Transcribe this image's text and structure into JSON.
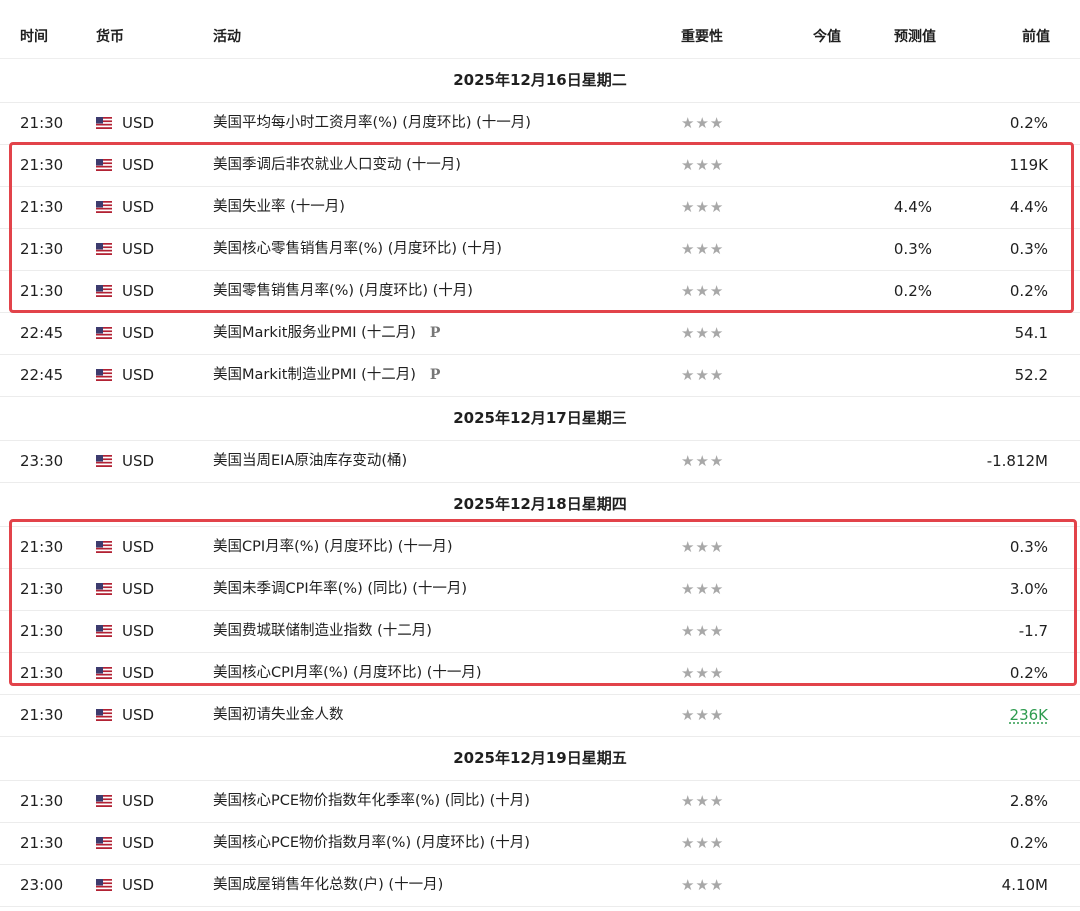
{
  "header": {
    "time": "时间",
    "currency": "货币",
    "event": "活动",
    "importance": "重要性",
    "actual": "今值",
    "forecast": "预测值",
    "previous": "前值"
  },
  "stars": "★★★",
  "prelim_label": "P",
  "sections": [
    {
      "date": "2025年12月16日星期二",
      "rows": [
        {
          "time": "21:30",
          "currency": "USD",
          "event": "美国平均每小时工资月率(%) (月度环比) (十一月)",
          "actual": "",
          "forecast": "",
          "previous": "0.2%"
        },
        {
          "time": "21:30",
          "currency": "USD",
          "event": "美国季调后非农就业人口变动 (十一月)",
          "actual": "",
          "forecast": "",
          "previous": "119K"
        },
        {
          "time": "21:30",
          "currency": "USD",
          "event": "美国失业率 (十一月)",
          "actual": "",
          "forecast": "4.4%",
          "previous": "4.4%"
        },
        {
          "time": "21:30",
          "currency": "USD",
          "event": "美国核心零售销售月率(%) (月度环比) (十月)",
          "actual": "",
          "forecast": "0.3%",
          "previous": "0.3%"
        },
        {
          "time": "21:30",
          "currency": "USD",
          "event": "美国零售销售月率(%) (月度环比) (十月)",
          "actual": "",
          "forecast": "0.2%",
          "previous": "0.2%"
        },
        {
          "time": "22:45",
          "currency": "USD",
          "event": "美国Markit服务业PMI (十二月)",
          "actual": "",
          "forecast": "",
          "previous": "54.1"
        },
        {
          "time": "22:45",
          "currency": "USD",
          "event": "美国Markit制造业PMI (十二月)",
          "actual": "",
          "forecast": "",
          "previous": "52.2"
        }
      ]
    },
    {
      "date": "2025年12月17日星期三",
      "rows": [
        {
          "time": "23:30",
          "currency": "USD",
          "event": "美国当周EIA原油库存变动(桶)",
          "actual": "",
          "forecast": "",
          "previous": "-1.812M"
        }
      ]
    },
    {
      "date": "2025年12月18日星期四",
      "rows": [
        {
          "time": "21:30",
          "currency": "USD",
          "event": "美国CPI月率(%) (月度环比) (十一月)",
          "actual": "",
          "forecast": "",
          "previous": "0.3%"
        },
        {
          "time": "21:30",
          "currency": "USD",
          "event": "美国未季调CPI年率(%) (同比) (十一月)",
          "actual": "",
          "forecast": "",
          "previous": "3.0%"
        },
        {
          "time": "21:30",
          "currency": "USD",
          "event": "美国费城联储制造业指数 (十二月)",
          "actual": "",
          "forecast": "",
          "previous": "-1.7"
        },
        {
          "time": "21:30",
          "currency": "USD",
          "event": "美国核心CPI月率(%) (月度环比) (十一月)",
          "actual": "",
          "forecast": "",
          "previous": "0.2%"
        },
        {
          "time": "21:30",
          "currency": "USD",
          "event": "美国初请失业金人数",
          "actual": "",
          "forecast": "",
          "previous": "236K"
        }
      ]
    },
    {
      "date": "2025年12月19日星期五",
      "rows": [
        {
          "time": "21:30",
          "currency": "USD",
          "event": "美国核心PCE物价指数年化季率(%) (同比) (十月)",
          "actual": "",
          "forecast": "",
          "previous": "2.8%"
        },
        {
          "time": "21:30",
          "currency": "USD",
          "event": "美国核心PCE物价指数月率(%) (月度环比) (十月)",
          "actual": "",
          "forecast": "",
          "previous": "0.2%"
        },
        {
          "time": "23:00",
          "currency": "USD",
          "event": "美国成屋销售年化总数(户) (十一月)",
          "actual": "",
          "forecast": "",
          "previous": "4.10M"
        }
      ]
    }
  ],
  "colors": {
    "highlight": "#e2434a",
    "previous_green": "#2e9b4f",
    "stars": "#a8a8a8"
  }
}
